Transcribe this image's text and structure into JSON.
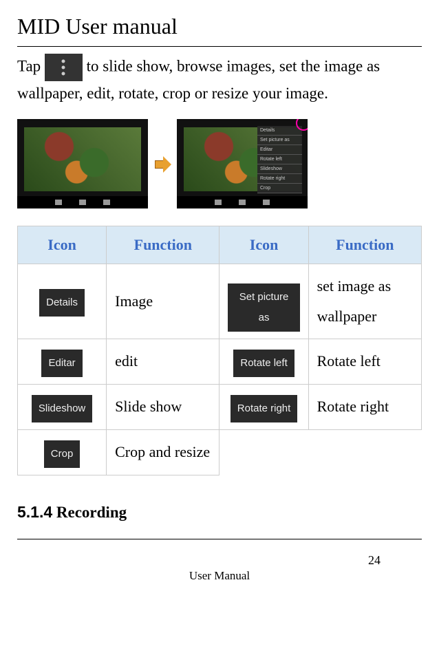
{
  "doc_title": "MID User manual",
  "intro": {
    "before": "Tap",
    "after": "to slide show, browse images, set the image as wallpaper, edit, rotate, crop or resize your image."
  },
  "menu_items": [
    "Details",
    "Set picture as",
    "Editar",
    "Rotate left",
    "Slideshow",
    "Rotate right",
    "Crop"
  ],
  "table": {
    "headers": {
      "icon": "Icon",
      "function": "Function"
    },
    "rows": [
      {
        "icon1": "Details",
        "func1": "Image",
        "icon2": "Set picture as",
        "func2": "set image as wallpaper"
      },
      {
        "icon1": "Editar",
        "func1": "edit",
        "icon2": "Rotate left",
        "func2": "Rotate left"
      },
      {
        "icon1": "Slideshow",
        "func1": "Slide show",
        "icon2": "Rotate right",
        "func2": "Rotate right"
      },
      {
        "icon1": "Crop",
        "func1": "Crop and resize",
        "icon2": "",
        "func2": ""
      }
    ]
  },
  "section": {
    "number": "5.1.4",
    "title": "Recording"
  },
  "footer": {
    "page": "24",
    "label": "User Manual"
  }
}
